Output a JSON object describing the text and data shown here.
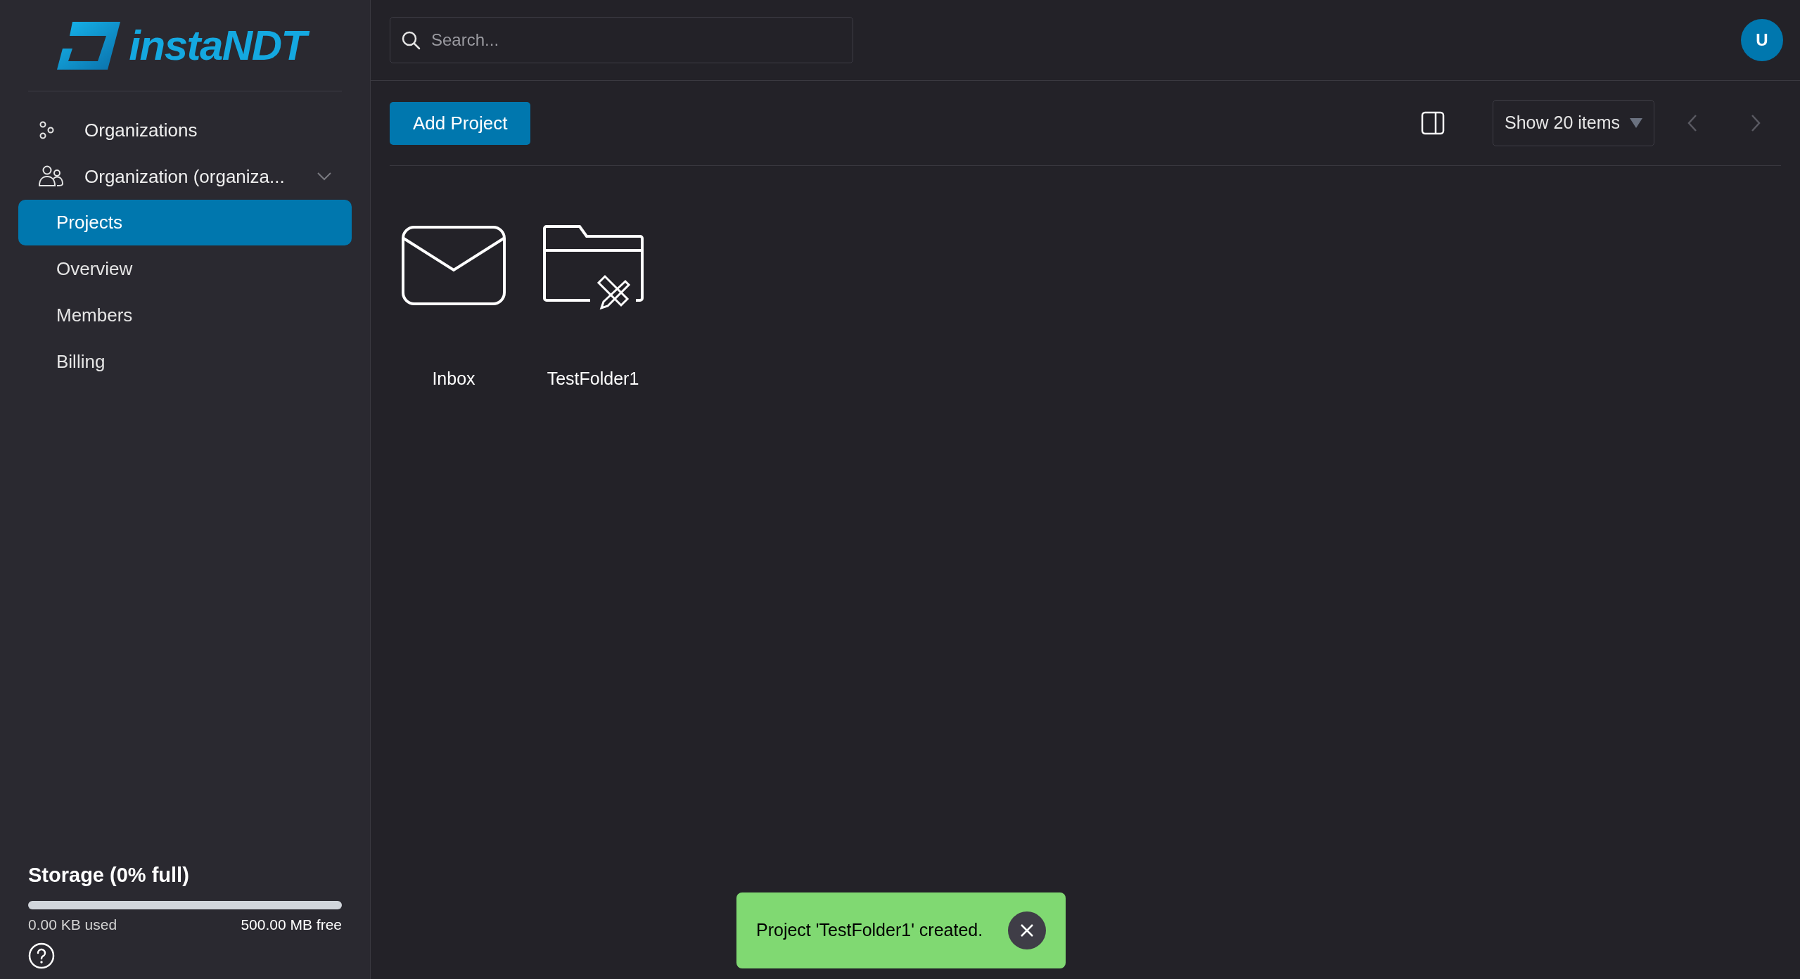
{
  "logo": {
    "text": "instaNDT"
  },
  "sidebar": {
    "items": [
      {
        "label": "Organizations",
        "kind": "nodes"
      },
      {
        "label": "Organization (organiza...",
        "kind": "people",
        "expanded": true,
        "children": [
          {
            "label": "Projects",
            "selected": true
          },
          {
            "label": "Overview",
            "selected": false
          },
          {
            "label": "Members",
            "selected": false
          },
          {
            "label": "Billing",
            "selected": false
          }
        ]
      }
    ]
  },
  "storage": {
    "title": "Storage (0% full)",
    "level": 0,
    "used": "0.00 KB used",
    "free": "500.00 MB free"
  },
  "search": {
    "placeholder": "Search..."
  },
  "avatar": {
    "initial": "U"
  },
  "toolbar": {
    "add_button": "Add Project",
    "page_size": "Show 20 items"
  },
  "projects": [
    {
      "name": "Inbox",
      "kind": "inbox"
    },
    {
      "name": "TestFolder1",
      "kind": "folder"
    }
  ],
  "toast": {
    "message": "Project 'TestFolder1' created."
  }
}
